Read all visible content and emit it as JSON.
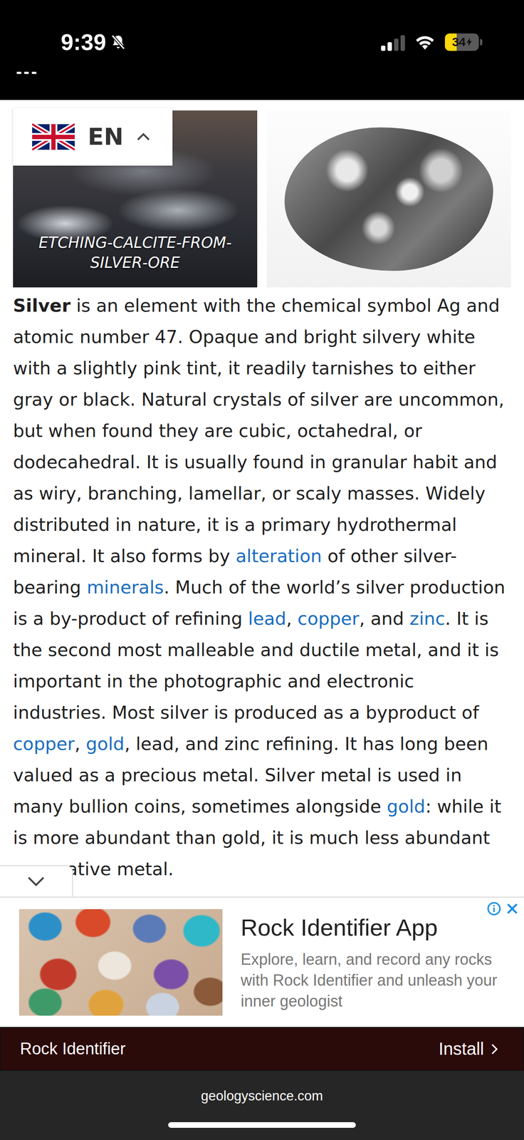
{
  "status_bar": {
    "time": "9:39",
    "silent": true,
    "signal_level": 0.5,
    "wifi": true,
    "battery": "34",
    "battery_level": 0.34,
    "low_power": true,
    "charging": true
  },
  "toolbar": {
    "text": "---"
  },
  "language": {
    "code": "EN",
    "expanded": true
  },
  "gallery": {
    "caption": "ETCHING-CALCITE-FROM-SILVER-ORE"
  },
  "article": {
    "segments": [
      {
        "kind": "bold",
        "text": "Silver"
      },
      {
        "kind": "text",
        "text": " is an element with the chemical symbol Ag and atomic number 47. Opaque and bright silvery white with a slightly pink tint, it readily tarnishes to either gray or black. Natural crystals of silver are uncommon, but when found they are cubic, octahedral, or dodecahedral. It is usually found in granular habit and as wiry, branching, lamellar, or scaly masses. Widely distributed in nature, it is a primary hydrothermal mineral. It also forms by "
      },
      {
        "kind": "link",
        "text": "alteration"
      },
      {
        "kind": "text",
        "text": " of other silver-bearing "
      },
      {
        "kind": "link",
        "text": "minerals"
      },
      {
        "kind": "text",
        "text": ". Much of the world’s silver production is a by-product of refining "
      },
      {
        "kind": "link",
        "text": "lead"
      },
      {
        "kind": "text",
        "text": ", "
      },
      {
        "kind": "link",
        "text": "copper"
      },
      {
        "kind": "text",
        "text": ", and "
      },
      {
        "kind": "link",
        "text": "zinc"
      },
      {
        "kind": "text",
        "text": ". It is the second most malleable and ductile metal, and it is important in the photographic and electronic industries. Most silver is produced as a byproduct of "
      },
      {
        "kind": "link",
        "text": "copper"
      },
      {
        "kind": "text",
        "text": ", "
      },
      {
        "kind": "link",
        "text": "gold"
      },
      {
        "kind": "text",
        "text": ", lead, and zinc refining. It has long been valued as a precious metal. Silver metal is used in many bullion coins, sometimes alongside "
      },
      {
        "kind": "link",
        "text": "gold"
      },
      {
        "kind": "text",
        "text": ": while it is more abundant than gold, it is much less abundant as a native metal."
      }
    ]
  },
  "ad": {
    "title": "Rock Identifier App",
    "description": "Explore, learn, and record any rocks with Rock Identifier and unleash your inner geologist",
    "advertiser": "Rock Identifier",
    "action": "Install"
  },
  "address_bar": {
    "url": "geologyscience.com"
  }
}
